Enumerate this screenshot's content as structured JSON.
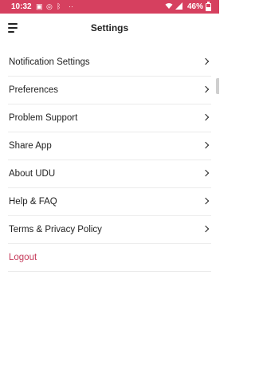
{
  "status_bar": {
    "time": "10:32",
    "battery": "46%",
    "left_icons": [
      "image-icon",
      "instagram-icon",
      "bluetooth-icon",
      "more-icon"
    ],
    "right_icons": [
      "wifi-icon",
      "signal-icon",
      "battery-icon"
    ],
    "battery_level": 0.46,
    "color": "#d6405f"
  },
  "header": {
    "title": "Settings"
  },
  "settings": {
    "items": [
      {
        "label": "Notification Settings"
      },
      {
        "label": "Preferences"
      },
      {
        "label": "Problem Support"
      },
      {
        "label": "Share App"
      },
      {
        "label": "About UDU"
      },
      {
        "label": "Help & FAQ"
      },
      {
        "label": "Terms & Privacy Policy"
      }
    ],
    "logout_label": "Logout",
    "logout_color": "#c53a5a"
  }
}
